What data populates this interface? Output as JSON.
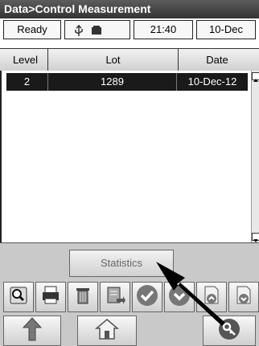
{
  "title_bar": {
    "text": "Data>Control Measurement"
  },
  "status_bar": {
    "state": "Ready",
    "time": "21:40",
    "date": "10-Dec"
  },
  "table": {
    "headers": [
      "Level",
      "Lot",
      "Date"
    ],
    "rows": [
      {
        "level": "2",
        "lot": "1289",
        "date": "10-Dec-12"
      }
    ]
  },
  "buttons": {
    "statistics": "Statistics"
  },
  "icons": {
    "toolbar": [
      "magnifier-icon",
      "printer-icon",
      "trash-icon",
      "export-icon",
      "check-icon",
      "down-arrow-circle-icon",
      "page-up-icon",
      "page-down-icon"
    ],
    "nav": [
      "up-arrow-icon",
      "home-icon",
      "key-icon"
    ]
  },
  "colors": {
    "title_bar": "#333333",
    "selected_row": "#1a1a1a",
    "check_icon": "#777777",
    "house_icon": "#555555"
  }
}
